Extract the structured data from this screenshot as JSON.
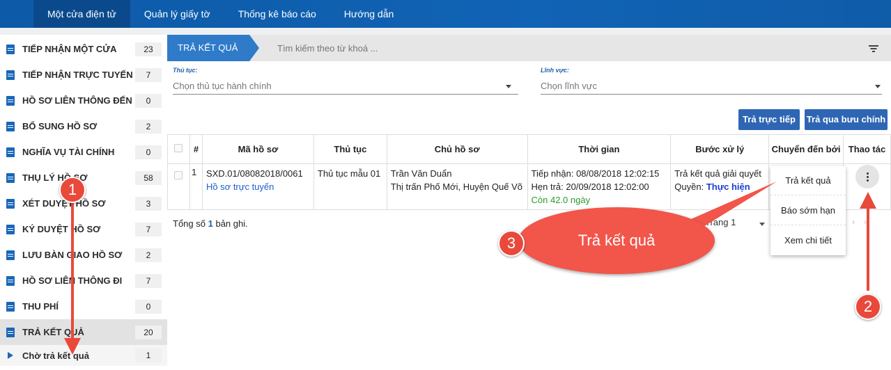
{
  "nav": {
    "items": [
      "Một cửa điện tử",
      "Quản lý giấy tờ",
      "Thống kê báo cáo",
      "Hướng dẫn"
    ],
    "active_index": 0
  },
  "sidebar": {
    "items": [
      {
        "label": "TIẾP NHẬN MỘT CỬA",
        "count": "23"
      },
      {
        "label": "TIẾP NHẬN TRỰC TUYẾN",
        "count": "7"
      },
      {
        "label": "HỒ SƠ LIÊN THÔNG ĐẾN",
        "count": "0"
      },
      {
        "label": "BỔ SUNG HỒ SƠ",
        "count": "2"
      },
      {
        "label": "NGHĨA VỤ TÀI CHÍNH",
        "count": "0"
      },
      {
        "label": "THỤ LÝ HỒ SƠ",
        "count": "58"
      },
      {
        "label": "XÉT DUYỆT HỒ SƠ",
        "count": "3"
      },
      {
        "label": "KÝ DUYỆT HỒ SƠ",
        "count": "7"
      },
      {
        "label": "LƯU BÀN GIAO HỒ SƠ",
        "count": "2"
      },
      {
        "label": "HỒ SƠ LIÊN THÔNG ĐI",
        "count": "7"
      },
      {
        "label": "THU PHÍ",
        "count": "0"
      },
      {
        "label": "TRẢ KẾT QUẢ",
        "count": "20"
      }
    ],
    "sub_item": {
      "label": "Chờ trả kết quả",
      "count": "1"
    }
  },
  "main": {
    "crumb": "TRẢ KẾT QUẢ",
    "search_placeholder": "Tìm kiếm theo từ khoá ...",
    "filters": {
      "procedure_label": "Thủ tục:",
      "procedure_placeholder": "Chọn thủ tục hành chính",
      "field_label": "Lĩnh vực:",
      "field_placeholder": "Chọn lĩnh vực"
    },
    "buttons": {
      "direct": "Trả trực tiếp",
      "postal": "Trả qua bưu chính"
    },
    "table": {
      "headers": [
        "#",
        "Mã hồ sơ",
        "Thủ tục",
        "Chủ hồ sơ",
        "Thời gian",
        "Bước xử lý",
        "Chuyển đến bởi",
        "Thao tác"
      ],
      "rows": [
        {
          "index": "1",
          "code": "SXD.01/08082018/0061",
          "channel": "Hồ sơ trực tuyến",
          "procedure": "Thủ tục mẫu 01",
          "owner_name": "Trần Văn Duẩn",
          "owner_address": "Thị trấn Phố Mới, Huyện Quế Võ",
          "received": "Tiếp nhận: 08/08/2018 12:02:15",
          "due": "Hẹn trả: 20/09/2018 12:02:00",
          "remaining": "Còn 42.0 ngày",
          "step": "Trả kết quả giải quyết",
          "permission_label": "Quyền:",
          "permission_value": "Thực hiện"
        }
      ]
    },
    "total": {
      "prefix": "Tổng số",
      "count": "1",
      "suffix": "bản ghi."
    },
    "page": "Trang 1",
    "menu": [
      "Trả kết quả",
      "Báo sớm hạn",
      "Xem chi tiết"
    ]
  },
  "annotations": {
    "step1": "1",
    "step2": "2",
    "step3": "3",
    "callout": "Trả kết quả"
  },
  "colors": {
    "nav_bg": "#1163b5",
    "accent": "#2f7bc9",
    "button": "#2f66b3",
    "annotation": "#e9493b"
  }
}
